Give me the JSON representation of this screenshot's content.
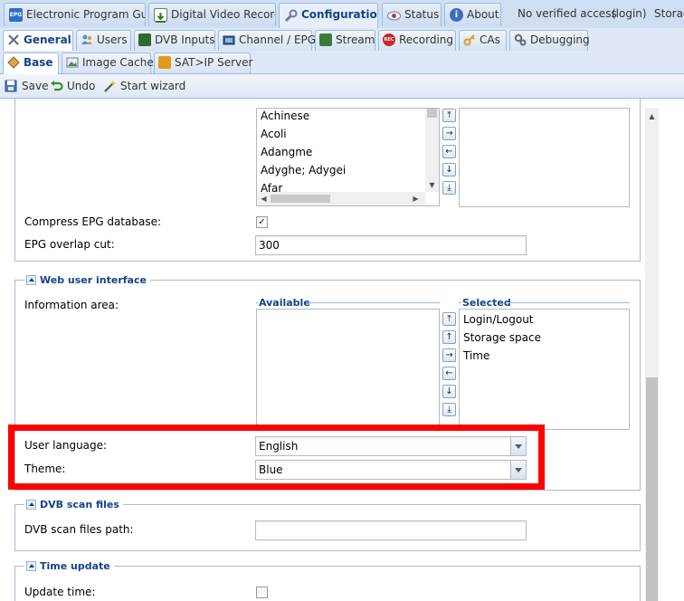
{
  "top_tabs": [
    {
      "label": "Electronic Program Guide",
      "icon": "epg-icon"
    },
    {
      "label": "Digital Video Recorder",
      "icon": "download-icon"
    },
    {
      "label": "Configuration",
      "icon": "wrench-icon"
    },
    {
      "label": "Status",
      "icon": "eye-icon"
    },
    {
      "label": "About",
      "icon": "info-icon"
    }
  ],
  "access_status": "No verified access",
  "login_link": "(login)",
  "storage_label": "Storage",
  "config_tabs": [
    {
      "label": "General",
      "icon": "tools-icon"
    },
    {
      "label": "Users",
      "icon": "users-icon"
    },
    {
      "label": "DVB Inputs",
      "icon": "chip-icon"
    },
    {
      "label": "Channel / EPG",
      "icon": "tv-icon"
    },
    {
      "label": "Stream",
      "icon": "stream-icon"
    },
    {
      "label": "Recording",
      "icon": "rec-icon"
    },
    {
      "label": "CAs",
      "icon": "key-icon"
    },
    {
      "label": "Debugging",
      "icon": "gears-icon"
    }
  ],
  "general_tabs": [
    {
      "label": "Base",
      "icon": "base-icon"
    },
    {
      "label": "Image Cache",
      "icon": "image-icon"
    },
    {
      "label": "SAT>IP Server",
      "icon": "satip-icon"
    }
  ],
  "toolbar": {
    "save": "Save",
    "undo": "Undo",
    "wizard": "Start wizard"
  },
  "epg": {
    "languages": [
      "Achinese",
      "Acoli",
      "Adangme",
      "Adyghe; Adygei",
      "Afar"
    ],
    "compress_label": "Compress EPG database:",
    "compress_checked": true,
    "overlap_label": "EPG overlap cut:",
    "overlap_value": "300"
  },
  "web_ui": {
    "legend": "Web user interface",
    "info_area_label": "Information area:",
    "available_header": "Available",
    "selected_header": "Selected",
    "selected_items": [
      "Login/Logout",
      "Storage space",
      "Time"
    ],
    "language_label": "User language:",
    "language_value": "English",
    "theme_label": "Theme:",
    "theme_value": "Blue"
  },
  "dvb_scan": {
    "legend": "DVB scan files",
    "path_label": "DVB scan files path:",
    "path_value": ""
  },
  "time_update": {
    "legend": "Time update",
    "update_label": "Update time:",
    "update_checked": false
  },
  "glyphs": {
    "up_top": "⤒",
    "up": "↑",
    "right": "→",
    "left": "←",
    "down": "↓",
    "down_bottom": "⤓",
    "check": "✓",
    "scroll_up": "▲",
    "scroll_left": "◀",
    "scroll_right": "▶",
    "scroll_down": "▼"
  }
}
